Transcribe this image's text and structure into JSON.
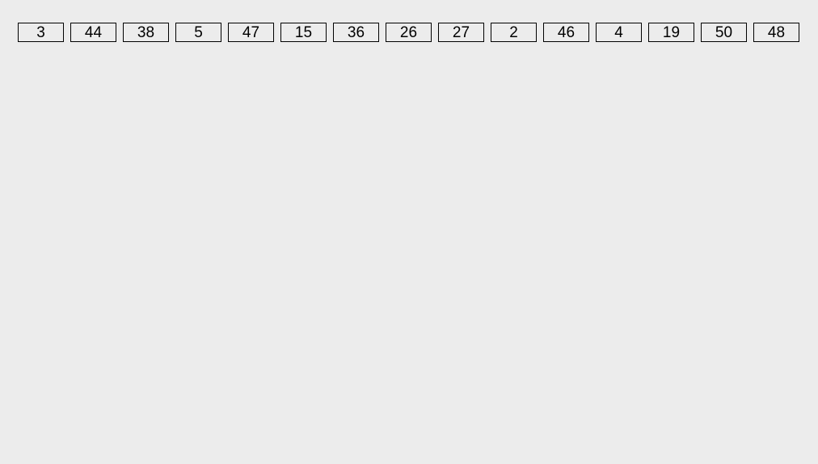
{
  "numbers": [
    {
      "value": "3"
    },
    {
      "value": "44"
    },
    {
      "value": "38"
    },
    {
      "value": "5"
    },
    {
      "value": "47"
    },
    {
      "value": "15"
    },
    {
      "value": "36"
    },
    {
      "value": "26"
    },
    {
      "value": "27"
    },
    {
      "value": "2"
    },
    {
      "value": "46"
    },
    {
      "value": "4"
    },
    {
      "value": "19"
    },
    {
      "value": "50"
    },
    {
      "value": "48"
    }
  ]
}
